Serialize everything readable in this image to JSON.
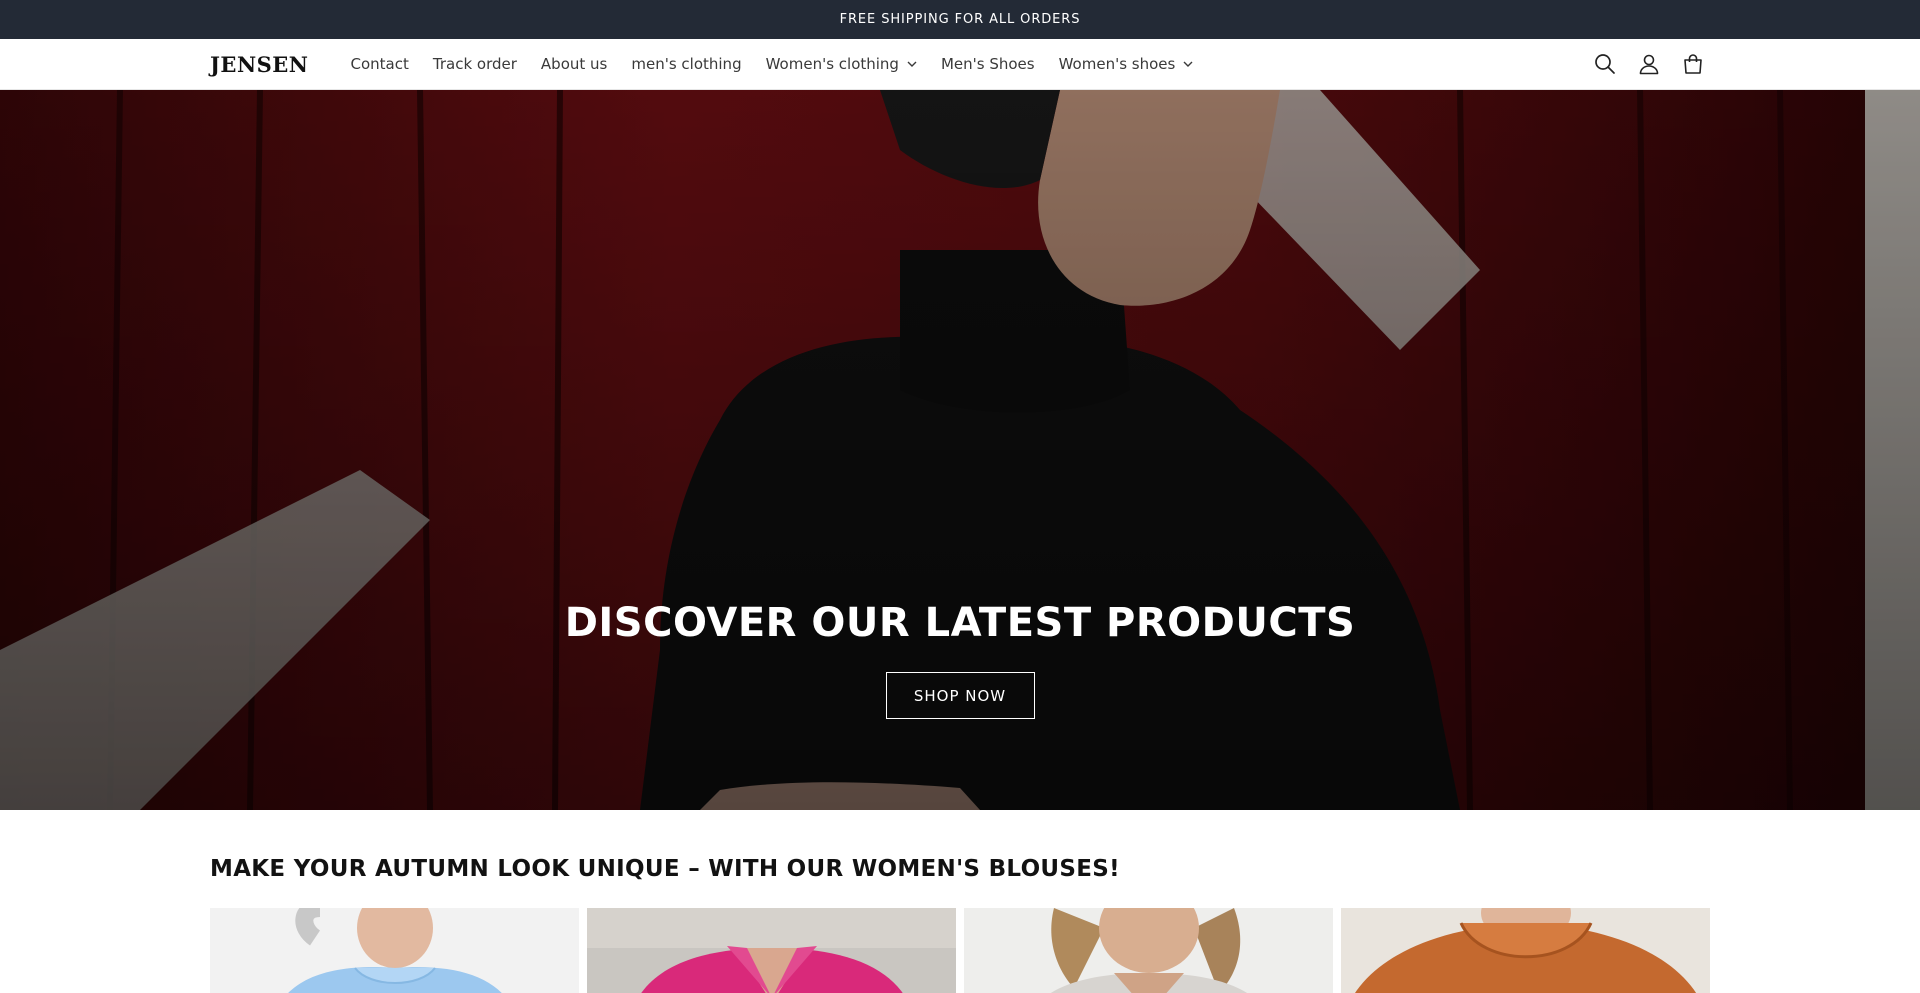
{
  "announcement": {
    "text": "FREE SHIPPING FOR ALL ORDERS"
  },
  "header": {
    "logo": "JENSEN",
    "nav": [
      {
        "label": "Contact",
        "dropdown": false
      },
      {
        "label": "Track order",
        "dropdown": false
      },
      {
        "label": "About us",
        "dropdown": false
      },
      {
        "label": "men's clothing",
        "dropdown": false
      },
      {
        "label": "Women's clothing",
        "dropdown": true
      },
      {
        "label": "Men's Shoes",
        "dropdown": false
      },
      {
        "label": "Women's shoes",
        "dropdown": true
      }
    ],
    "icons": [
      "search-icon",
      "account-icon",
      "cart-icon"
    ]
  },
  "hero": {
    "title": "DISCOVER OUR LATEST PRODUCTS",
    "button_label": "SHOP NOW"
  },
  "collection": {
    "title": "MAKE YOUR AUTUMN LOOK UNIQUE – WITH OUR WOMEN'S BLOUSES!",
    "products": [
      {
        "image": "light-blue-blouse"
      },
      {
        "image": "pink-blouse"
      },
      {
        "image": "grey-blouse"
      },
      {
        "image": "rust-blouse"
      }
    ]
  },
  "colors": {
    "announcement_bg": "#232a36",
    "hero_red": "#5a0f12",
    "text": "#121212"
  }
}
